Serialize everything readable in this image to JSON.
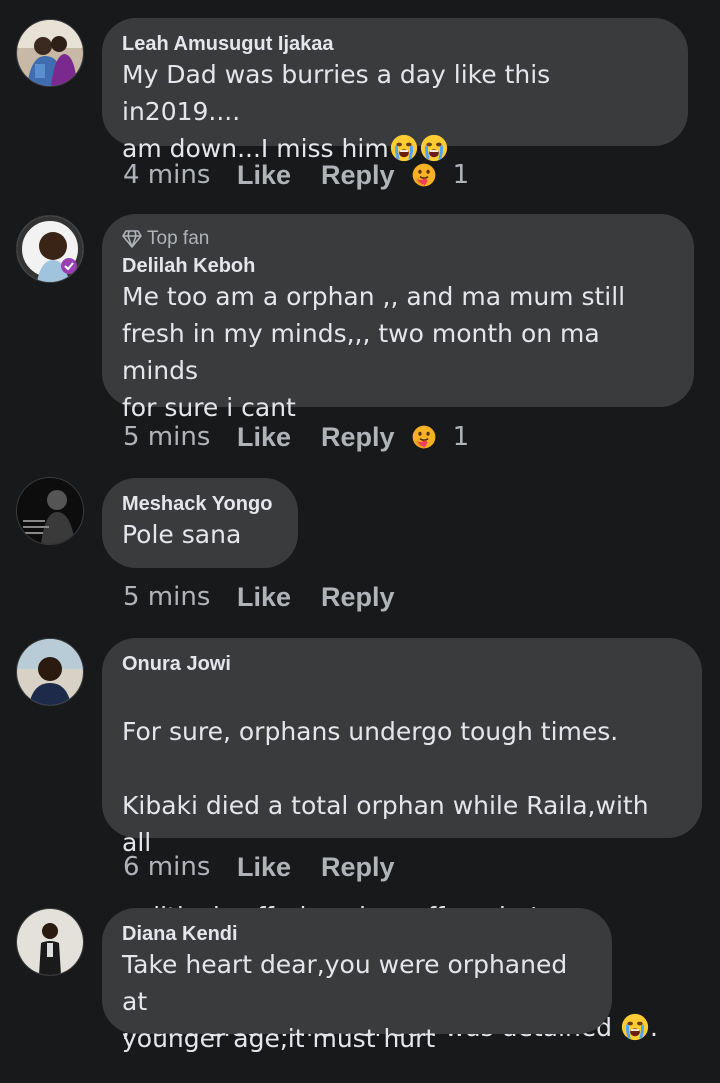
{
  "comments": [
    {
      "author": "Leah Amusugut Ijakaa",
      "badge": "",
      "text": "My Dad was burries a day like this in2019....\nam down...I miss him",
      "emojis": [
        "crying-face-emoji",
        "crying-face-emoji"
      ],
      "time": "4 mins",
      "like": "Like",
      "reply": "Reply",
      "reaction_icon": "care-reaction-icon",
      "reaction_count": "1"
    },
    {
      "author": "Delilah Keboh",
      "badge": "Top fan",
      "badge_icon": "diamond-icon",
      "text": "Me too am a orphan ,, and ma mum still\nfresh in my minds,,, two month on ma minds\nfor sure i cant",
      "time": "5 mins",
      "like": "Like",
      "reply": "Reply",
      "reaction_icon": "care-reaction-icon",
      "reaction_count": "1"
    },
    {
      "author": "Meshack Yongo",
      "badge": "",
      "text": "Pole sana",
      "time": "5 mins",
      "like": "Like",
      "reply": "Reply"
    },
    {
      "author": "Onura Jowi",
      "badge": "",
      "text_lines": [
        "For sure, orphans undergo tough times.",
        "Kibaki died a total orphan while Raila,with all",
        "political sufferings he suffers, he's an orphan",
        ";Maria died while her son was detained"
      ],
      "text_end": ".",
      "emojis": [
        "crying-face-emoji"
      ],
      "time": "6 mins",
      "like": "Like",
      "reply": "Reply"
    },
    {
      "author": "Diana Kendi",
      "badge": "",
      "text": "Take heart dear,you were orphaned at\nyounger age,it must hurt"
    }
  ],
  "colors": {
    "background": "#18191a",
    "bubble": "#3a3b3c",
    "primary_text": "#e4e6eb",
    "secondary_text": "#b0b3b8",
    "care_reaction": "#f7b125"
  }
}
